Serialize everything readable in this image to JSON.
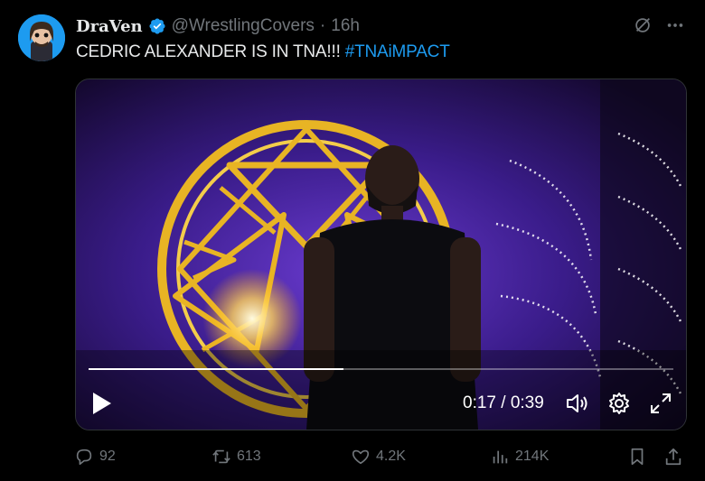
{
  "author": {
    "display_name": "DraVen",
    "handle": "@WrestlingCovers",
    "separator": "·",
    "time": "16h"
  },
  "tweet": {
    "text": "CEDRIC ALEXANDER IS IN TNA!!! ",
    "hashtag": "#TNAiMPACT"
  },
  "video": {
    "time_readout": "0:17 / 0:39",
    "progress": 0.436
  },
  "actions": {
    "replies": "92",
    "reposts": "613",
    "likes": "4.2K",
    "views": "214K"
  },
  "colors": {
    "accent": "#1d9bf0",
    "muted": "#71767b",
    "background": "#000000"
  }
}
